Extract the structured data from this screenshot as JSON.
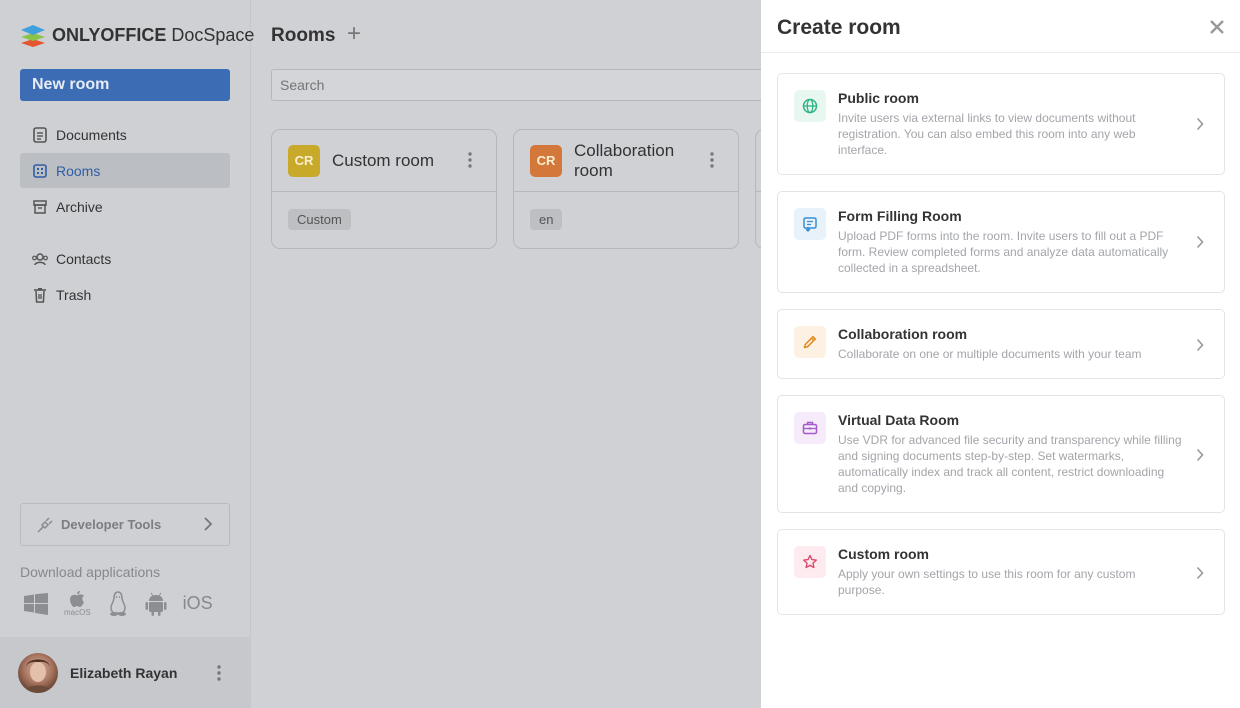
{
  "brand": {
    "bold": "ONLYOFFICE",
    "rest": " DocSpace"
  },
  "sidebar": {
    "new_room_label": "New room",
    "items": [
      {
        "label": "Documents",
        "icon": "document-icon"
      },
      {
        "label": "Rooms",
        "icon": "rooms-icon",
        "active": true
      },
      {
        "label": "Archive",
        "icon": "archive-icon"
      },
      {
        "label": "Contacts",
        "icon": "contacts-icon"
      },
      {
        "label": "Trash",
        "icon": "trash-icon"
      }
    ],
    "developer_tools_label": "Developer Tools",
    "download_label": "Download applications",
    "apps": {
      "ios_label": "iOS",
      "macos_label": "macOS"
    },
    "user_name": "Elizabeth Rayan"
  },
  "main": {
    "title": "Rooms",
    "search_placeholder": "Search",
    "cards": [
      {
        "badge": "CR",
        "badge_color": "#c9a92a",
        "title": "Custom room",
        "tag": "Custom"
      },
      {
        "badge": "CR",
        "badge_color": "#d4773a",
        "title": "Collaboration room",
        "tag": "en"
      }
    ]
  },
  "panel": {
    "title": "Create room",
    "options": [
      {
        "title": "Public room",
        "description": "Invite users via external links to view documents without registration. You can also embed this room into any web interface.",
        "icon": "globe-icon",
        "color": "#2db482",
        "bg": "#e8f7f0"
      },
      {
        "title": "Form Filling Room",
        "description": "Upload PDF forms into the room. Invite users to fill out a PDF form. Review completed forms and analyze data automatically collected in a spreadsheet.",
        "icon": "form-icon",
        "color": "#3b8ed0",
        "bg": "#e7f2fb"
      },
      {
        "title": "Collaboration room",
        "description": "Collaborate on one or multiple documents with your team",
        "icon": "pencil-icon",
        "color": "#e0891f",
        "bg": "#fdf1e3"
      },
      {
        "title": "Virtual Data Room",
        "description": "Use VDR for advanced file security and transparency while filling and signing documents step-by-step. Set watermarks, automatically index and track all content, restrict downloading and copying.",
        "icon": "briefcase-icon",
        "color": "#a35bc9",
        "bg": "#f5ebfa"
      },
      {
        "title": "Custom room",
        "description": "Apply your own settings to use this room for any custom purpose.",
        "icon": "star-icon",
        "color": "#e0486c",
        "bg": "#fdebef"
      }
    ]
  }
}
